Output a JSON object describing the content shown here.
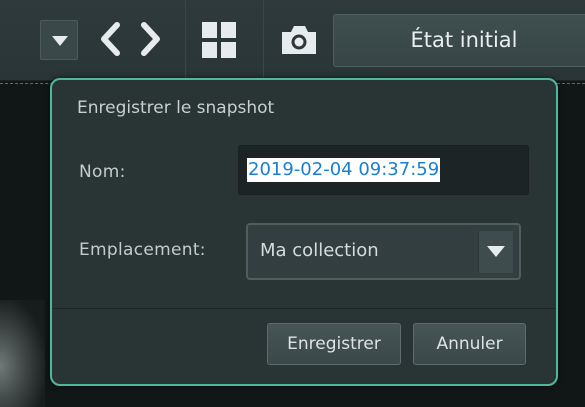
{
  "toolbar": {
    "state_button_label": "État initial",
    "icons": [
      "chevron-down-icon",
      "chevron-left-icon",
      "chevron-right-icon",
      "grid-layout-icon",
      "camera-icon"
    ]
  },
  "dialog": {
    "title": "Enregistrer le snapshot",
    "name_label": "Nom:",
    "name_value": "2019-02-04 09:37:59",
    "location_label": "Emplacement:",
    "location_value": "Ma collection",
    "save_label": "Enregistrer",
    "cancel_label": "Annuler"
  },
  "colors": {
    "dialog_border": "#4fb89c",
    "dialog_bg": "#293435",
    "selection_bg": "#ffffff",
    "selection_text": "#1a7fd0"
  }
}
